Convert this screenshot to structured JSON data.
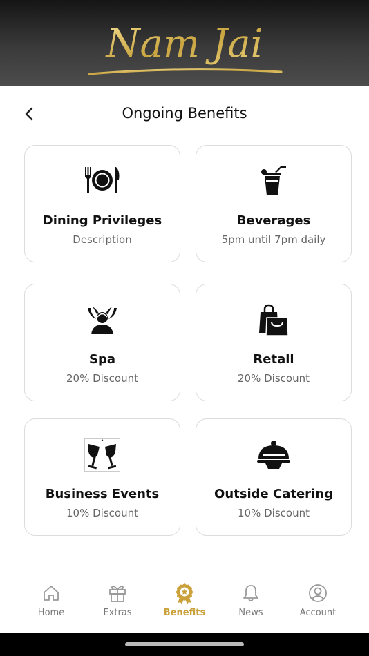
{
  "brand": {
    "name": "Nam Jai",
    "accent": "#caa13a"
  },
  "page": {
    "title": "Ongoing Benefits",
    "back_icon": "chevron-left-icon"
  },
  "benefits": [
    {
      "name": "Dining Privileges",
      "detail": "Description",
      "icon": "plate-cutlery-icon"
    },
    {
      "name": "Beverages",
      "detail": "5pm until 7pm daily",
      "icon": "drink-cup-icon"
    },
    {
      "name": "Spa",
      "detail": "20% Discount",
      "icon": "spa-icon"
    },
    {
      "name": "Retail",
      "detail": "20% Discount",
      "icon": "shopping-bag-icon"
    },
    {
      "name": "Business Events",
      "detail": "10% Discount",
      "icon": "champagne-glasses-icon"
    },
    {
      "name": "Outside Catering",
      "detail": "10% Discount",
      "icon": "food-cloche-icon"
    }
  ],
  "tabs": [
    {
      "label": "Home",
      "icon": "home-icon",
      "active": false
    },
    {
      "label": "Extras",
      "icon": "gift-icon",
      "active": false
    },
    {
      "label": "Benefits",
      "icon": "badge-icon",
      "active": true
    },
    {
      "label": "News",
      "icon": "bell-icon",
      "active": false
    },
    {
      "label": "Account",
      "icon": "user-circle-icon",
      "active": false
    }
  ]
}
